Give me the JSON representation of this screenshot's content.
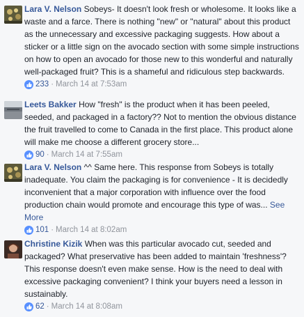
{
  "comments": [
    {
      "author": "Lara V. Nelson",
      "text": "Sobeys- It doesn't look fresh or wholesome. It looks like a waste and a farce. There is nothing \"new\" or \"natural\" about this product as the unnecessary and excessive packaging suggests. How about a sticker or a little sign on the avocado section with some simple instructions on how to open an avocado for those new to this wonderful and naturally well-packaged fruit? This is a shameful and ridiculous step backwards.",
      "likes": "233",
      "separator": "·",
      "timestamp": "March 14 at 7:53am"
    },
    {
      "author": "Leets Bakker",
      "text": "How \"fresh\" is the product when it has been peeled, seeded, and packaged in a factory?? Not to mention the obvious distance the fruit travelled to come to Canada in the first place. This product alone will make me choose a different grocery store...",
      "likes": "90",
      "separator": "·",
      "timestamp": "March 14 at 7:55am"
    },
    {
      "author": "Lara V. Nelson",
      "text": "^^ Same here. This response from Sobeys is totally inadequate. You claim the packaging is for convenience - It is decidedly inconvenient that a major corporation with influence over the food production chain would promote and encourage this type of was...",
      "see_more": "See More",
      "likes": "101",
      "separator": "·",
      "timestamp": "March 14 at 8:02am"
    },
    {
      "author": "Christine Kizik",
      "text": "When was this particular avocado cut, seeded and packaged? What preservative has been added to maintain 'freshness'? This response doesn't even make sense. How is the need to deal with excessive packaging convenient? I think your buyers need a lesson in sustainably.",
      "likes": "62",
      "separator": "·",
      "timestamp": "March 14 at 8:08am"
    }
  ],
  "colors": {
    "author": "#365899",
    "meta": "#90949c",
    "like_blue": "#5890ff",
    "background": "#f6f7f9"
  },
  "icons": {
    "like": "thumbs-up-icon"
  }
}
